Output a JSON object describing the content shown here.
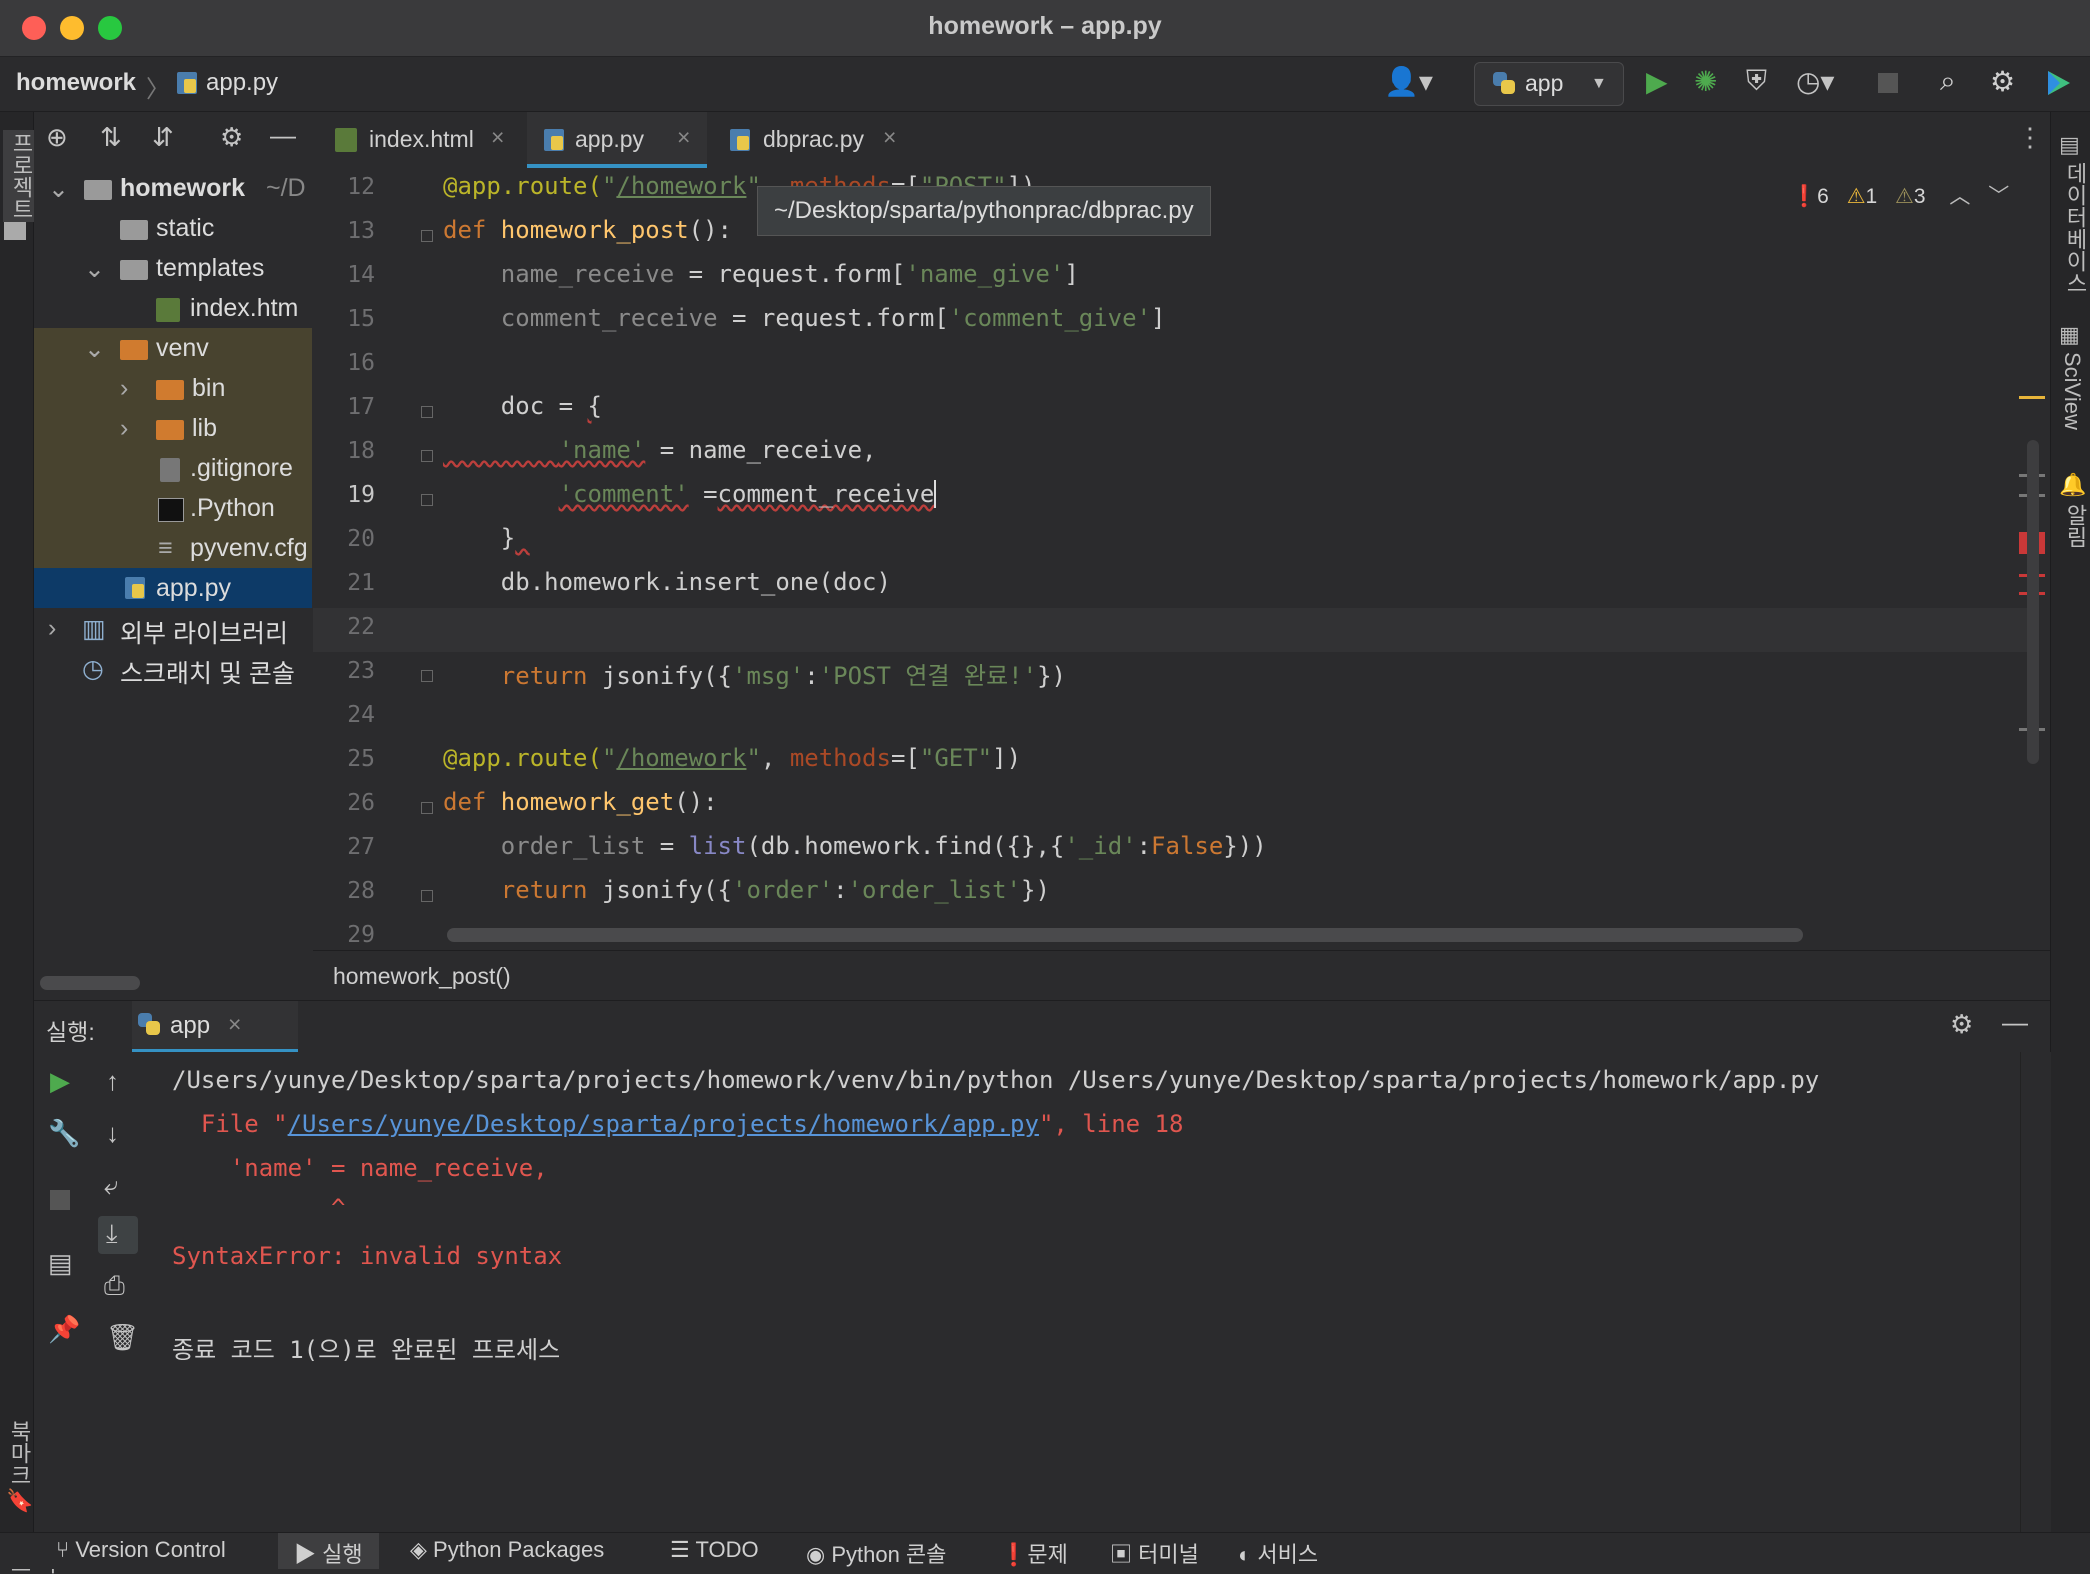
{
  "window": {
    "title": "homework – app.py"
  },
  "navbar": {
    "project": "homework",
    "separator": "〉",
    "file": "app.py",
    "run_config": "app"
  },
  "project_panel": {
    "tree": [
      {
        "label": "homework",
        "suffix": "~/D",
        "kind": "folder"
      },
      {
        "label": "static",
        "kind": "folder"
      },
      {
        "label": "templates",
        "kind": "folder"
      },
      {
        "label": "index.htm",
        "kind": "html"
      },
      {
        "label": "venv",
        "kind": "folder-orange"
      },
      {
        "label": "bin",
        "kind": "folder-orange"
      },
      {
        "label": "lib",
        "kind": "folder-orange"
      },
      {
        "label": ".gitignore",
        "kind": "file"
      },
      {
        "label": ".Python",
        "kind": "file"
      },
      {
        "label": "pyvenv.cfg",
        "kind": "file"
      },
      {
        "label": "app.py",
        "kind": "python"
      },
      {
        "label": "외부 라이브러리",
        "kind": "lib"
      },
      {
        "label": "스크래치 및 콘솔",
        "kind": "scratch"
      }
    ]
  },
  "left_strip": {
    "project_label": "프로젝트",
    "bookmarks_label": "북마크",
    "structure_label": "구조"
  },
  "right_strip": {
    "database_label": "데이터베이스",
    "sciview_label": "SciView",
    "notifications_label": "알림"
  },
  "tabs": [
    {
      "label": "index.html",
      "close": "×"
    },
    {
      "label": "app.py",
      "close": "×",
      "active": true
    },
    {
      "label": "dbprac.py",
      "close": "×"
    }
  ],
  "tooltip": "~/Desktop/sparta/pythonprac/dbprac.py",
  "inspections": {
    "errors": "6",
    "warnings": "1",
    "weak": "3"
  },
  "editor": {
    "line_numbers": [
      "12",
      "13",
      "14",
      "15",
      "16",
      "17",
      "18",
      "19",
      "20",
      "21",
      "22",
      "23",
      "24",
      "25",
      "26",
      "27",
      "28",
      "29"
    ],
    "lines": [
      "@app.route(\"/homework\", methods=[\"POST\"])",
      "def homework_post():",
      "    name_receive = request.form['name_give']",
      "    comment_receive = request.form['comment_give']",
      "",
      "    doc = {",
      "        'name' = name_receive,",
      "        'comment' =comment_receive",
      "    }",
      "    db.homework.insert_one(doc)",
      "",
      "    return jsonify({'msg':'POST 연결 완료!'})",
      "",
      "@app.route(\"/homework\", methods=[\"GET\"])",
      "def homework_get():",
      "    order_list = list(db.homework.find({},{'_id':False}))",
      "    return jsonify({'order':'order_list'})",
      ""
    ]
  },
  "breadcrumb": "homework_post()",
  "run_panel": {
    "label": "실행:",
    "tab": "app",
    "tab_close": "×",
    "console": {
      "cmd": "/Users/yunye/Desktop/sparta/projects/homework/venv/bin/python /Users/yunye/Desktop/sparta/projects/homework/app.py",
      "file_prefix": "  File \"",
      "file_link": "/Users/yunye/Desktop/sparta/projects/homework/app.py",
      "file_suffix": "\", line 18",
      "code_line": "    'name' = name_receive,",
      "caret": "           ^",
      "error": "SyntaxError: invalid syntax",
      "exit": "종료 코드 1(으)로 완료된 프로세스"
    }
  },
  "statusbar": [
    {
      "label": "Version Control",
      "icon": "branch-icon"
    },
    {
      "label": "실행",
      "icon": "run-icon"
    },
    {
      "label": "Python Packages",
      "icon": "packages-icon"
    },
    {
      "label": "TODO",
      "icon": "todo-icon"
    },
    {
      "label": "Python 콘솔",
      "icon": "python-console-icon"
    },
    {
      "label": "문제",
      "icon": "problems-icon"
    },
    {
      "label": "터미널",
      "icon": "terminal-icon"
    },
    {
      "label": "서비스",
      "icon": "services-icon"
    }
  ],
  "colors": {
    "accent": "#3592c4",
    "error": "#e0564f",
    "run_green": "#4eaa4e",
    "selection": "#0d3a67"
  }
}
